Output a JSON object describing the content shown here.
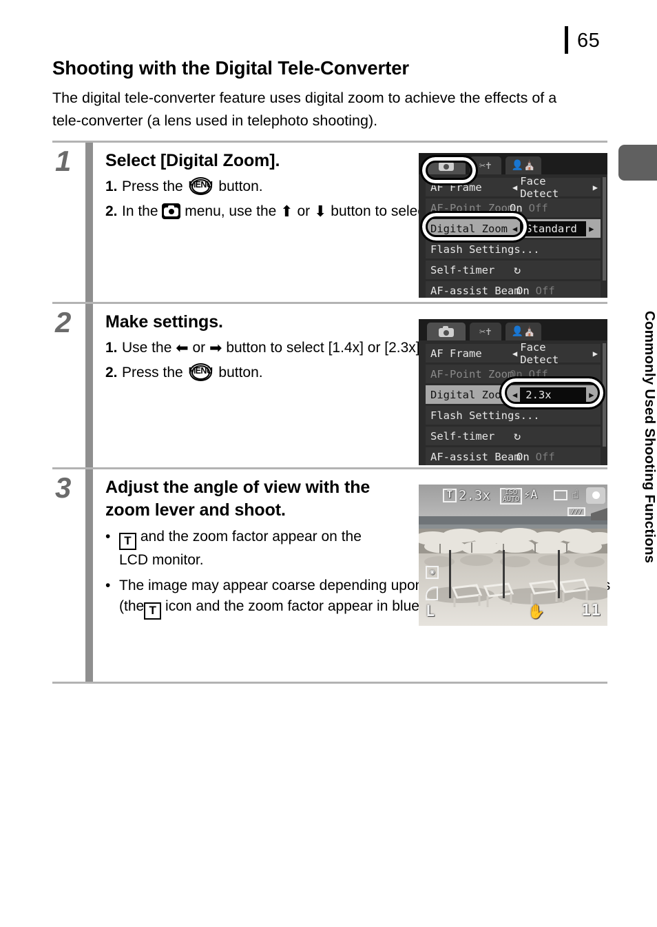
{
  "page": {
    "number": "65",
    "side_tab_label": "Commonly Used Shooting Functions"
  },
  "section": {
    "title": "Shooting with the Digital Tele-Converter",
    "intro": "The digital tele-converter feature uses digital zoom to achieve the effects of a tele-converter (a lens used in telephoto shooting)."
  },
  "steps": [
    {
      "number": "1",
      "heading": "Select [Digital Zoom].",
      "substeps": [
        {
          "marker": "1.",
          "text_before": "Press the",
          "icon": "menu-button-icon",
          "text_after": "button."
        },
        {
          "marker": "2.",
          "text_a": "In the",
          "icon": "shooting-menu-icon",
          "text_b": "menu, use the",
          "arrow_up": "⬆",
          "text_c": "or",
          "arrow_down": "⬇",
          "text_d": "button to select [Digital Zoom]."
        }
      ]
    },
    {
      "number": "2",
      "heading": "Make settings.",
      "substeps": [
        {
          "marker": "1.",
          "text_a": "Use the",
          "arrow_left": "⬅",
          "text_b": "or",
          "arrow_right": "➡",
          "text_c": "button to select [1.4x] or [2.3x]."
        },
        {
          "marker": "2.",
          "text_before": "Press the",
          "icon": "menu-button-icon",
          "text_after": "button."
        }
      ]
    },
    {
      "number": "3",
      "heading": "Adjust the angle of view with the zoom lever and shoot.",
      "bullets": [
        {
          "dot": "•",
          "text_before": "",
          "icon": "T",
          "text_after": "and the zoom factor appear on the LCD monitor."
        },
        {
          "dot": "•",
          "text_before": "The image may appear coarse depending upon the selected recording pixels (the",
          "icon": "T",
          "text_after": "icon and the zoom factor appear in blue)."
        }
      ]
    }
  ],
  "lcd_menu_step1": {
    "tabs": [
      {
        "name": "shooting",
        "selected": true
      },
      {
        "name": "settings",
        "selected": false
      },
      {
        "name": "my-camera",
        "selected": false
      }
    ],
    "rows": [
      {
        "label": "AF Frame",
        "value": "Face Detect",
        "type": "chevron"
      },
      {
        "label": "AF-Point Zoom",
        "on": "On",
        "off": "Off",
        "type": "onoff",
        "dim": true
      },
      {
        "label": "Digital Zoom",
        "value": "Standard",
        "type": "chevron",
        "highlight": true
      },
      {
        "label": "Flash Settings...",
        "value": "",
        "type": "plain"
      },
      {
        "label": "Self-timer",
        "value": "↺",
        "type": "plain"
      },
      {
        "label": "AF-assist Beam",
        "on": "On",
        "off": "Off",
        "type": "onoff"
      }
    ],
    "highlights": [
      "shooting-tab",
      "digital-zoom-row"
    ]
  },
  "lcd_menu_step2": {
    "tabs": [
      {
        "name": "shooting",
        "selected": true
      },
      {
        "name": "settings",
        "selected": false
      },
      {
        "name": "my-camera",
        "selected": false
      }
    ],
    "rows": [
      {
        "label": "AF Frame",
        "value": "Face Detect",
        "type": "chevron"
      },
      {
        "label": "AF-Point Zoom",
        "on": "On",
        "off": "Off",
        "type": "onoff",
        "dim": true
      },
      {
        "label": "Digital Zoom",
        "value": "2.3x",
        "type": "chevron",
        "highlight": true
      },
      {
        "label": "Flash Settings...",
        "value": "",
        "type": "plain"
      },
      {
        "label": "Self-timer",
        "value": "↺",
        "type": "plain"
      },
      {
        "label": "AF-assist Beam",
        "on": "On",
        "off": "Off",
        "type": "onoff"
      }
    ],
    "highlights": [
      "digital-zoom-value"
    ]
  },
  "lcd_preview": {
    "zoom_indicator_icon": "T",
    "zoom_factor": "2.3x",
    "iso_label": "ISO",
    "iso_value": "AUTO",
    "flash_mode": "auto-flash",
    "frame_icon": "frame-icon",
    "shake_icon": "camera-shake-icon",
    "battery_icon": "battery-icon",
    "mode_icon": "auto-mode-icon",
    "metering_icon": "metering-icon",
    "quality_icon": "superfine-icon",
    "image_size": "L",
    "hand_icon": "hand-shake-warning-icon",
    "shots_remaining": "11"
  }
}
